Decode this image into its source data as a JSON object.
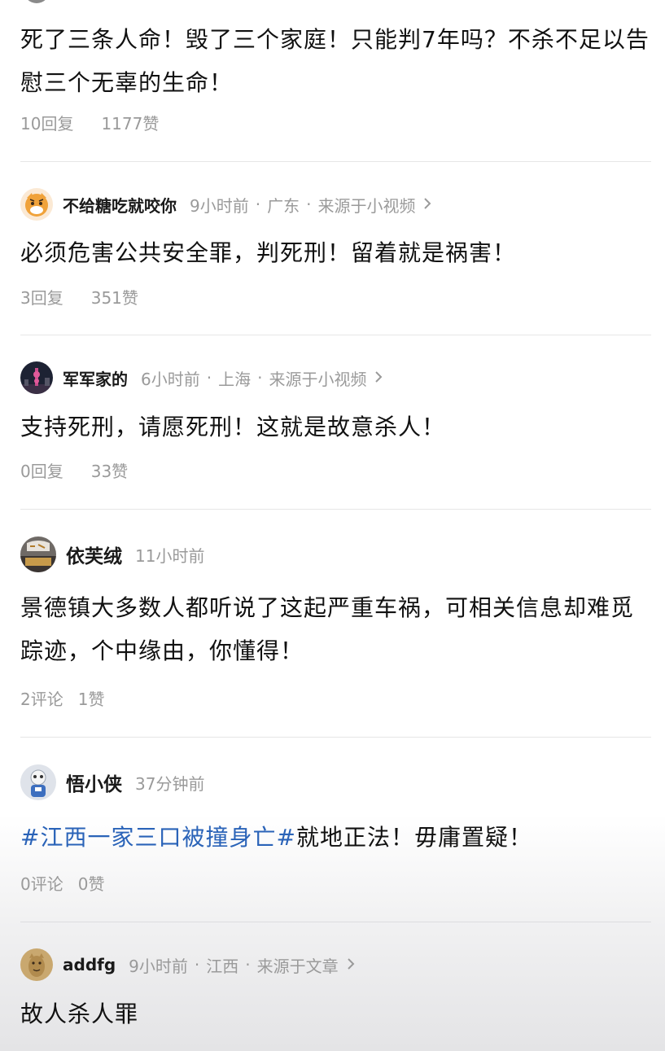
{
  "comments": [
    {
      "text": "死了三条人命！毁了三个家庭！只能判7年吗？不杀不足以告慰三个无辜的生命！",
      "replies": "10回复",
      "likes": "1177赞"
    },
    {
      "username": "不给糖吃就咬你",
      "time": "9小时前",
      "location": "广东",
      "source": "来源于小视频",
      "text": "必须危害公共安全罪，判死刑！留着就是祸害！",
      "replies": "3回复",
      "likes": "351赞"
    },
    {
      "username": "军军家的",
      "time": "6小时前",
      "location": "上海",
      "source": "来源于小视频",
      "text": "支持死刑，请愿死刑！这就是故意杀人！",
      "replies": "0回复",
      "likes": "33赞"
    },
    {
      "username": "依芙绒",
      "time": "11小时前",
      "text": "景德镇大多数人都听说了这起严重车祸，可相关信息却难觅踪迹，个中缘由，你懂得！",
      "replies": "2评论",
      "likes": "1赞"
    },
    {
      "username": "悟小侠",
      "time": "37分钟前",
      "hashtag": "#江西一家三口被撞身亡#",
      "text": "就地正法！毋庸置疑！",
      "replies": "0评论",
      "likes": "0赞"
    },
    {
      "username": "addfg",
      "time": "9小时前",
      "location": "江西",
      "source": "来源于文章",
      "text": "故人杀人罪"
    }
  ],
  "colors": {
    "hashtag": "#2a63b8",
    "meta": "#9a9a9a",
    "divider": "#e6e6e6"
  },
  "icons": [
    "chevron-right-icon",
    "avatar"
  ]
}
